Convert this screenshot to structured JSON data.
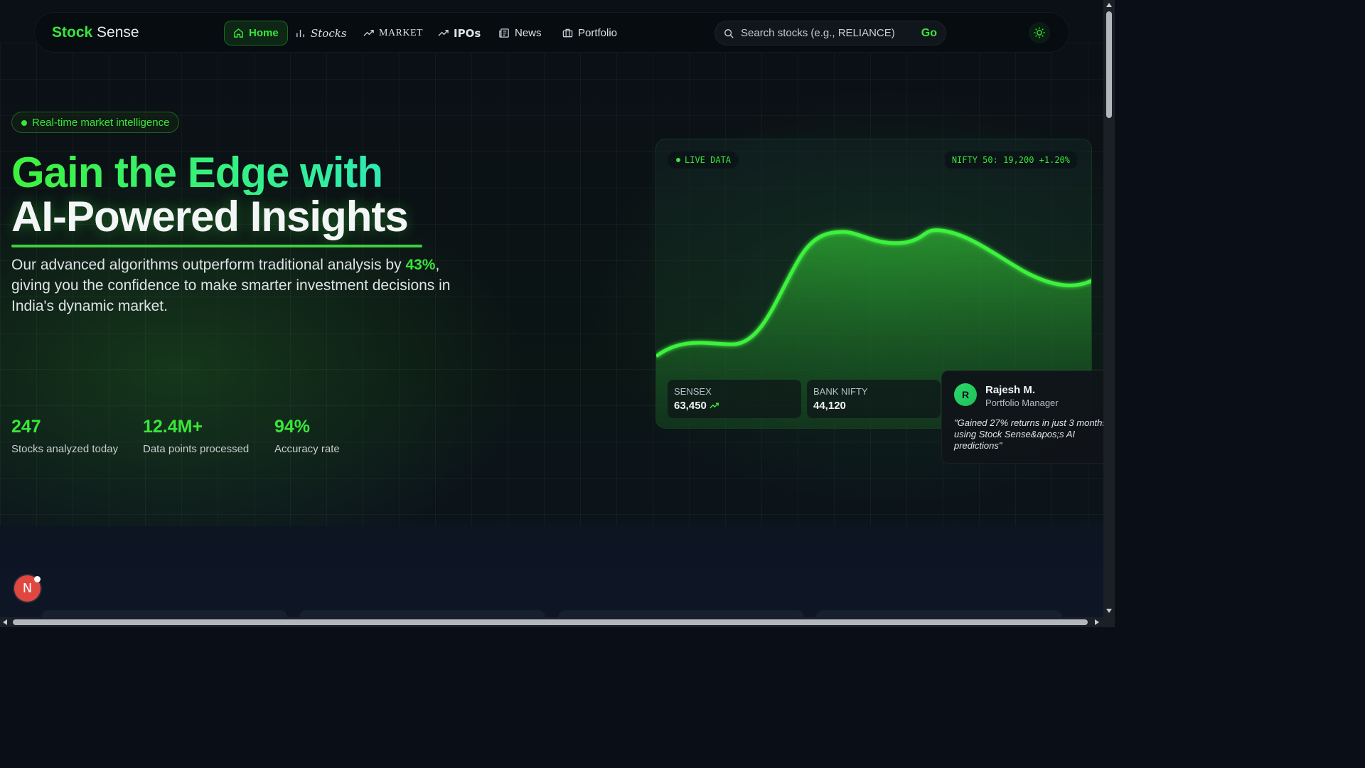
{
  "brand": {
    "part1": "Stock",
    "part2": "Sense"
  },
  "nav": {
    "home": "Home",
    "stocks": "Stocks",
    "market": "MARKET",
    "ipos": "IPOs",
    "news": "News",
    "portfolio": "Portfolio"
  },
  "search": {
    "placeholder": "Search stocks (e.g., RELIANCE)",
    "value": "",
    "go_label": "Go"
  },
  "hero": {
    "pill": "Real-time market intelligence",
    "title_line1": "Gain the Edge with",
    "title_line2": "AI-Powered Insights",
    "desc_before": "Our advanced algorithms outperform traditional analysis by ",
    "desc_highlight": "43%",
    "desc_after": ", giving you the confidence to make smarter investment decisions in India's dynamic market."
  },
  "stats": [
    {
      "value": "247",
      "label": "Stocks analyzed today"
    },
    {
      "value": "12.4M+",
      "label": "Data points processed"
    },
    {
      "value": "94%",
      "label": "Accuracy rate"
    }
  ],
  "chart_card": {
    "live_label": "LIVE DATA",
    "nifty_label": "NIFTY 50: 19,200 +1.20%",
    "tiles": [
      {
        "label": "SENSEX",
        "value": "63,450"
      },
      {
        "label": "BANK NIFTY",
        "value": "44,120"
      }
    ]
  },
  "testimonial": {
    "initial": "R",
    "name": "Rajesh M.",
    "role": "Portfolio Manager",
    "quote": "\"Gained 27% returns in just 3 months using Stock Sense&apos;s AI predictions\""
  },
  "badge": {
    "letter": "N"
  },
  "colors": {
    "accent": "#39e639",
    "background": "#0a0f17",
    "teal": "#2be6d8"
  }
}
